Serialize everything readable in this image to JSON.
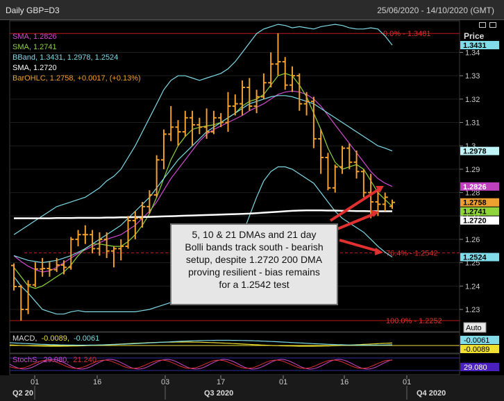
{
  "window": {
    "title": "Daily GBP=D3",
    "date_range": "25/06/2020 - 14/10/2020 (GMT)"
  },
  "legend": [
    {
      "text": "SMA, 1.2826",
      "color": "#d14bd1"
    },
    {
      "text": "SMA, 1.2741",
      "color": "#8fd43a"
    },
    {
      "text": "BBand, 1.3431, 1.2978, 1.2524",
      "color": "#7fdce8"
    },
    {
      "text": "SMA, 1.2720",
      "color": "#ffffff"
    },
    {
      "text": "BarOHLC, 1.2758, +0.0017, (+0.13%)",
      "color": "#f0a030"
    }
  ],
  "price_axis": {
    "header": "Price",
    "ticks": [
      "1.34",
      "1.33",
      "1.32",
      "1.31",
      "1.3",
      "1.29",
      "1.28",
      "1.27",
      "1.26",
      "1.25",
      "1.24",
      "1.23"
    ],
    "badges": [
      {
        "text": "1.3431",
        "value": 1.3431,
        "bg": "#7fdce8",
        "fg": "#000"
      },
      {
        "text": "1.2978",
        "value": 1.2978,
        "bg": "#bff4f8",
        "fg": "#000"
      },
      {
        "text": "1.2826",
        "value": 1.2826,
        "bg": "#c040c0",
        "fg": "#fff"
      },
      {
        "text": "1.2758",
        "value": 1.2758,
        "bg": "#f0a030",
        "fg": "#000"
      },
      {
        "text": "1.2741",
        "value": 1.2741,
        "bg": "#8fd43a",
        "fg": "#000"
      },
      {
        "text": "1.2720",
        "value": 1.272,
        "bg": "#ffffff",
        "fg": "#000"
      },
      {
        "text": "1.2524",
        "value": 1.2524,
        "bg": "#7fdce8",
        "fg": "#000"
      }
    ],
    "auto_label": "Auto"
  },
  "fib_levels": [
    {
      "label": "0.0% - 1.3481",
      "value": 1.3481
    },
    {
      "label": "76.4% - 1.2542",
      "value": 1.2542
    },
    {
      "label": "100.0% - 1.2252",
      "value": 1.2252
    }
  ],
  "annotation": {
    "lines": [
      "5, 10 & 21 DMAs and 21 day",
      "Bolli bands track south - bearish",
      "setup, despite 1.2720 200 DMA",
      "proving resilient - bias remains",
      "for a 1.2542 test"
    ]
  },
  "macd_panel": {
    "label_name": "MACD,",
    "macd_value": "-0.0089,",
    "signal_value": "-0.0061",
    "badges": [
      {
        "text": "-0.0061",
        "bg": "#7fdce8"
      },
      {
        "text": "-0.0089",
        "bg": "#f0e030"
      }
    ]
  },
  "stoch_panel": {
    "label_name": "StochS,",
    "k_value": "29.080,",
    "d_value": "21.240",
    "badge": "29.080"
  },
  "x_axis": {
    "ticks": [
      "01",
      "16",
      "03",
      "17",
      "01",
      "16",
      "01"
    ],
    "periods": [
      "Q2 20",
      "Q3 2020",
      "Q4 2020"
    ]
  },
  "chart_data": {
    "type": "ohlc",
    "x_range": [
      "2020-06-25",
      "2020-10-14"
    ],
    "ylim": [
      1.2205,
      1.3535
    ],
    "bars_ohlc": [
      [
        1.2488,
        1.2497,
        1.2381,
        1.2398
      ],
      [
        1.2398,
        1.2405,
        1.2252,
        1.23
      ],
      [
        1.23,
        1.2425,
        1.228,
        1.2405
      ],
      [
        1.2405,
        1.2502,
        1.2395,
        1.2473
      ],
      [
        1.2473,
        1.252,
        1.244,
        1.2475
      ],
      [
        1.2475,
        1.2505,
        1.244,
        1.247
      ],
      [
        1.247,
        1.252,
        1.246,
        1.249
      ],
      [
        1.249,
        1.251,
        1.245,
        1.248
      ],
      [
        1.248,
        1.261,
        1.247,
        1.26
      ],
      [
        1.26,
        1.264,
        1.257,
        1.262
      ],
      [
        1.262,
        1.266,
        1.258,
        1.262
      ],
      [
        1.262,
        1.264,
        1.254,
        1.256
      ],
      [
        1.256,
        1.263,
        1.253,
        1.26
      ],
      [
        1.26,
        1.263,
        1.252,
        1.255
      ],
      [
        1.255,
        1.257,
        1.248,
        1.256
      ],
      [
        1.256,
        1.26,
        1.251,
        1.257
      ],
      [
        1.257,
        1.27,
        1.256,
        1.268
      ],
      [
        1.268,
        1.272,
        1.26,
        1.269
      ],
      [
        1.269,
        1.276,
        1.265,
        1.274
      ],
      [
        1.274,
        1.281,
        1.271,
        1.279
      ],
      [
        1.279,
        1.296,
        1.278,
        1.294
      ],
      [
        1.294,
        1.307,
        1.29,
        1.305
      ],
      [
        1.305,
        1.317,
        1.302,
        1.308
      ],
      [
        1.308,
        1.311,
        1.3,
        1.306
      ],
      [
        1.306,
        1.315,
        1.304,
        1.312
      ],
      [
        1.312,
        1.315,
        1.3,
        1.309
      ],
      [
        1.309,
        1.312,
        1.305,
        1.308
      ],
      [
        1.308,
        1.316,
        1.303,
        1.306
      ],
      [
        1.306,
        1.315,
        1.305,
        1.312
      ],
      [
        1.312,
        1.314,
        1.308,
        1.31
      ],
      [
        1.31,
        1.323,
        1.306,
        1.317
      ],
      [
        1.317,
        1.322,
        1.313,
        1.318
      ],
      [
        1.318,
        1.328,
        1.313,
        1.325
      ],
      [
        1.325,
        1.329,
        1.315,
        1.317
      ],
      [
        1.317,
        1.324,
        1.314,
        1.321
      ],
      [
        1.321,
        1.331,
        1.32,
        1.327
      ],
      [
        1.327,
        1.34,
        1.325,
        1.335
      ],
      [
        1.335,
        1.3482,
        1.33,
        1.336
      ],
      [
        1.336,
        1.338,
        1.324,
        1.326
      ],
      [
        1.326,
        1.334,
        1.323,
        1.33
      ],
      [
        1.33,
        1.331,
        1.315,
        1.318
      ],
      [
        1.318,
        1.323,
        1.313,
        1.319
      ],
      [
        1.319,
        1.321,
        1.299,
        1.303
      ],
      [
        1.303,
        1.307,
        1.288,
        1.295
      ],
      [
        1.295,
        1.297,
        1.281,
        1.282
      ],
      [
        1.282,
        1.292,
        1.28,
        1.291
      ],
      [
        1.291,
        1.3,
        1.288,
        1.299
      ],
      [
        1.299,
        1.301,
        1.29,
        1.293
      ],
      [
        1.293,
        1.298,
        1.286,
        1.289
      ],
      [
        1.289,
        1.29,
        1.278,
        1.28
      ],
      [
        1.28,
        1.288,
        1.269,
        1.276
      ],
      [
        1.276,
        1.282,
        1.27,
        1.275
      ],
      [
        1.275,
        1.28,
        1.272,
        1.278
      ],
      [
        1.2741,
        1.277,
        1.273,
        1.2758
      ]
    ],
    "series": [
      {
        "name": "SMA",
        "color": "#d14bd1",
        "values": [
          1.253,
          1.2505,
          1.2485,
          1.247,
          1.246,
          1.2465,
          1.248,
          1.25,
          1.252,
          1.254,
          1.2555,
          1.257,
          1.2585,
          1.26,
          1.261,
          1.262,
          1.264,
          1.266,
          1.269,
          1.272,
          1.276,
          1.281,
          1.286,
          1.29,
          1.294,
          1.298,
          1.302,
          1.305,
          1.307,
          1.3085,
          1.31,
          1.3115,
          1.313,
          1.315,
          1.3165,
          1.318,
          1.32,
          1.322,
          1.323,
          1.3235,
          1.323,
          1.322,
          1.32,
          1.317,
          1.313,
          1.309,
          1.305,
          1.301,
          1.297,
          1.293,
          1.289,
          1.286,
          1.284,
          1.2826
        ]
      },
      {
        "name": "SMA",
        "color": "#8fd43a",
        "values": [
          1.248,
          1.244,
          1.24,
          1.239,
          1.24,
          1.242,
          1.244,
          1.246,
          1.249,
          1.253,
          1.256,
          1.258,
          1.258,
          1.2575,
          1.257,
          1.257,
          1.259,
          1.262,
          1.266,
          1.271,
          1.278,
          1.286,
          1.294,
          1.3,
          1.304,
          1.307,
          1.308,
          1.3085,
          1.309,
          1.31,
          1.312,
          1.314,
          1.317,
          1.319,
          1.32,
          1.322,
          1.326,
          1.33,
          1.331,
          1.33,
          1.326,
          1.321,
          1.314,
          1.307,
          1.299,
          1.293,
          1.29,
          1.291,
          1.292,
          1.29,
          1.285,
          1.28,
          1.277,
          1.2741
        ]
      },
      {
        "name": "BBand",
        "color": "#7fdce8",
        "values": [
          1.262,
          1.264,
          1.266,
          1.268,
          1.27,
          1.272,
          1.274,
          1.275,
          1.276,
          1.277,
          1.278,
          1.28,
          1.282,
          1.285,
          1.287,
          1.29,
          1.295,
          1.3,
          1.306,
          1.312,
          1.318,
          1.324,
          1.328,
          1.33,
          1.33,
          1.329,
          1.328,
          1.329,
          1.33,
          1.331,
          1.333,
          1.336,
          1.34,
          1.344,
          1.348,
          1.35,
          1.351,
          1.352,
          1.3515,
          1.3505,
          1.351,
          1.3505,
          1.35,
          1.351,
          1.3515,
          1.352,
          1.3515,
          1.3505,
          1.35,
          1.35,
          1.3505,
          1.35,
          1.347,
          1.3431
        ]
      },
      {
        "name": "BBand",
        "color": "#7fdce8",
        "values": [
          1.253,
          1.252,
          1.251,
          1.2505,
          1.25,
          1.2505,
          1.251,
          1.252,
          1.253,
          1.2545,
          1.256,
          1.258,
          1.26,
          1.262,
          1.264,
          1.266,
          1.269,
          1.272,
          1.275,
          1.278,
          1.282,
          1.286,
          1.29,
          1.294,
          1.297,
          1.3,
          1.303,
          1.306,
          1.308,
          1.31,
          1.312,
          1.314,
          1.316,
          1.318,
          1.319,
          1.32,
          1.321,
          1.3215,
          1.3215,
          1.321,
          1.32,
          1.319,
          1.318,
          1.316,
          1.314,
          1.312,
          1.31,
          1.308,
          1.306,
          1.304,
          1.302,
          1.3,
          1.299,
          1.2978
        ]
      },
      {
        "name": "BBand",
        "color": "#7fdce8",
        "values": [
          1.244,
          1.24,
          1.237,
          1.2335,
          1.23,
          1.229,
          1.228,
          1.228,
          1.229,
          1.2295,
          1.229,
          1.229,
          1.229,
          1.229,
          1.229,
          1.229,
          1.229,
          1.229,
          1.2295,
          1.23,
          1.231,
          1.232,
          1.233,
          1.234,
          1.235,
          1.236,
          1.237,
          1.238,
          1.239,
          1.241,
          1.246,
          1.253,
          1.262,
          1.27,
          1.278,
          1.285,
          1.289,
          1.291,
          1.291,
          1.29,
          1.288,
          1.286,
          1.284,
          1.28,
          1.276,
          1.272,
          1.269,
          1.267,
          1.265,
          1.263,
          1.26,
          1.257,
          1.2545,
          1.2524
        ]
      },
      {
        "name": "SMA",
        "color": "#ffffff",
        "values": [
          1.269,
          1.269,
          1.269,
          1.269,
          1.269,
          1.269,
          1.2691,
          1.2691,
          1.2691,
          1.2692,
          1.2692,
          1.2692,
          1.2692,
          1.2693,
          1.2693,
          1.2694,
          1.2694,
          1.2695,
          1.2695,
          1.2696,
          1.2697,
          1.2698,
          1.2699,
          1.27,
          1.2701,
          1.2702,
          1.2703,
          1.2704,
          1.2705,
          1.2706,
          1.2707,
          1.2708,
          1.2709,
          1.271,
          1.2712,
          1.2714,
          1.2716,
          1.2718,
          1.272,
          1.2722,
          1.2723,
          1.2724,
          1.2724,
          1.2724,
          1.2723,
          1.2723,
          1.2722,
          1.2722,
          1.2721,
          1.2721,
          1.272,
          1.272,
          1.272,
          1.272
        ]
      }
    ]
  }
}
